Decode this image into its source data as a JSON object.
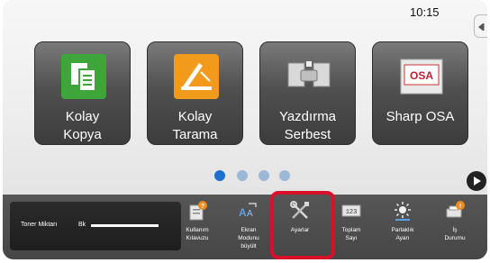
{
  "clock": "10:15",
  "apps": [
    {
      "line1": "Kolay",
      "line2": "Kopya",
      "icon": "copy-icon"
    },
    {
      "line1": "Kolay",
      "line2": "Tarama",
      "icon": "scan-icon"
    },
    {
      "line1": "Yazdırma",
      "line2": "Serbest",
      "icon": "print-release-icon"
    },
    {
      "line1": "Sharp OSA",
      "line2": "",
      "icon": "sharp-osa-icon",
      "logo_text": "OSA"
    }
  ],
  "page_indicator": {
    "pages": 4,
    "current": 1
  },
  "toner": {
    "label": "Toner Miktarı",
    "color": "Bk",
    "level": 1.0
  },
  "bottom_bar": [
    {
      "line1": "Kullanım",
      "line2": "Kılavuzu",
      "line3": "",
      "icon": "manual-icon"
    },
    {
      "line1": "Ekran",
      "line2": "Modunu",
      "line3": "büyült",
      "icon": "enlarge-display-icon"
    },
    {
      "line1": "Ayarlar",
      "line2": "",
      "line3": "",
      "icon": "settings-tools-icon"
    },
    {
      "line1": "Toplam",
      "line2": "Sayı",
      "line3": "",
      "icon": "total-count-icon",
      "counter_text": "123"
    },
    {
      "line1": "Parlaklık",
      "line2": "Ayarı",
      "line3": "",
      "icon": "brightness-icon"
    },
    {
      "line1": "İş",
      "line2": "Durumu",
      "line3": "",
      "icon": "job-status-icon"
    }
  ],
  "colors": {
    "highlight": "#d8102a",
    "active_dot": "#1f6fd0",
    "inactive_dot": "#9db8d6",
    "copy_green": "#3ea53a",
    "scan_orange": "#f29a1b",
    "badge_orange": "#f08c1e"
  }
}
